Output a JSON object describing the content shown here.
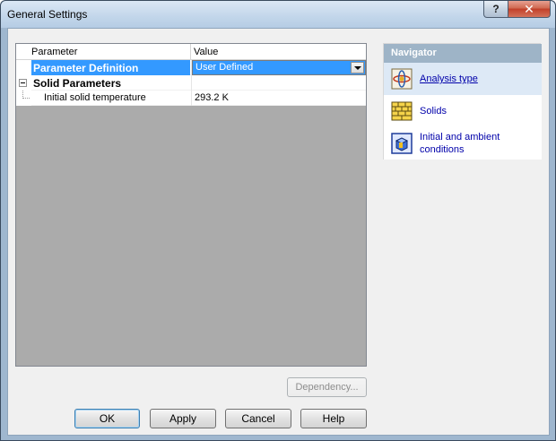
{
  "window": {
    "title": "General Settings",
    "help_glyph": "?",
    "close_glyph": "✕"
  },
  "grid": {
    "columns": [
      "Parameter",
      "Value"
    ],
    "rows": [
      {
        "parameter": "Parameter Definition",
        "value": "User Defined",
        "selected": true
      },
      {
        "parameter": "Solid Parameters",
        "value": "",
        "group": true
      },
      {
        "parameter": "Initial solid temperature",
        "value": "293.2 K"
      }
    ]
  },
  "navigator": {
    "title": "Navigator",
    "items": [
      {
        "label": "Analysis type",
        "icon": "analysis-type-icon"
      },
      {
        "label": "Solids",
        "icon": "solids-icon"
      },
      {
        "label_line1": "Initial and ambient",
        "label_line2": "conditions",
        "icon": "initial-conditions-icon"
      }
    ]
  },
  "buttons": {
    "dependency": "Dependency...",
    "ok": "OK",
    "apply": "Apply",
    "cancel": "Cancel",
    "help": "Help"
  },
  "colors": {
    "selection": "#3399ff",
    "nav_header": "#9eb4c7",
    "link": "#0000aa"
  }
}
